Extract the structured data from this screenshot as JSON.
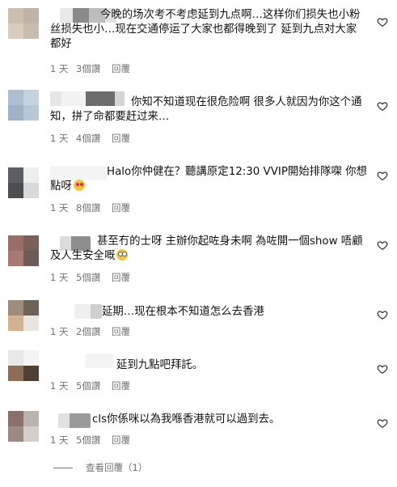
{
  "comments": [
    {
      "text": "今晚的场次考不考虑延到九点啊…这样你们损失也小粉丝损失也小…现在交通停运了大家也都得晚到了 延到九点对大家都好",
      "time": "1 天",
      "likes": "3個讚",
      "reply": "回覆"
    },
    {
      "text": "你知不知道现在很危险啊 很多人就因为你这个通知，拼了命都要赶过来…",
      "time": "1 天",
      "likes": "4個讚",
      "reply": "回覆"
    },
    {
      "text": "Halo你仲健在？聽講原定12:30 VVIP開始排隊㗎 你想點呀",
      "time": "1 天",
      "likes": "8個讚",
      "reply": "回覆"
    },
    {
      "text": "甚至冇的士呀 主辦你起咗身未啊 為咗開一個show 唔顧及人生安全嘅",
      "time": "1 天",
      "likes": "5個讚",
      "reply": "回覆"
    },
    {
      "text": "延期…现在根本不知道怎么去香港",
      "time": "1 天",
      "likes": "2個讚",
      "reply": "回覆"
    },
    {
      "text": "延到九點吧拜託。",
      "time": "1 天",
      "likes": "5個讚",
      "reply": "回覆"
    },
    {
      "text": "cls你係咪以為我喺香港就可以過到去。",
      "time": "1 天",
      "likes": "5個讚",
      "reply": "回覆"
    }
  ],
  "view_replies": "查看回覆（1）",
  "colors": {
    "text": "#121212",
    "meta": "#737373",
    "background": "#ffffff"
  },
  "icons": {
    "like": "heart-outline-icon"
  }
}
